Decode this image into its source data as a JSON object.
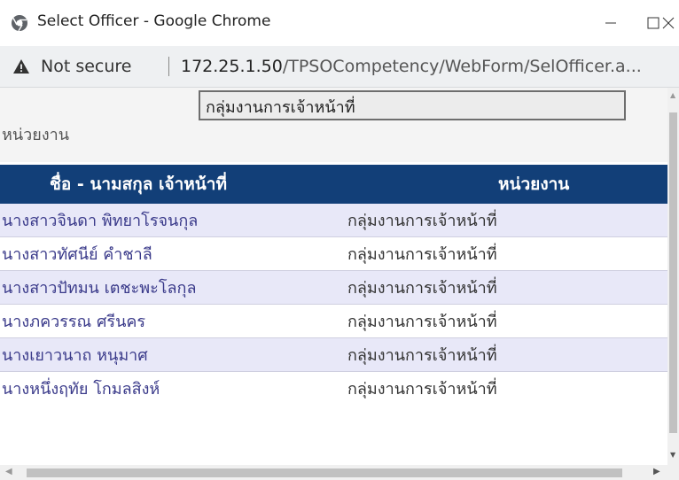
{
  "window": {
    "title": "Select Officer - Google Chrome",
    "controls": {
      "minimize": "—",
      "maximize": "☐",
      "close": "✕"
    },
    "icon": "chrome-globe-icon"
  },
  "address_bar": {
    "security_icon": "warning-triangle-icon",
    "security_text": "Not secure",
    "url_host": "172.25.1.50",
    "url_path": "/TPSOCompetency/WebForm/SelOfficer.a..."
  },
  "filter": {
    "label": "หน่วยงาน",
    "value": "กลุ่มงานการเจ้าหน้าที่"
  },
  "table": {
    "headers": {
      "name": "ชื่อ - นามสกุล เจ้าหน้าที่",
      "unit": "หน่วยงาน"
    },
    "rows": [
      {
        "name": "นางสาวจินดา พิทยาโรจนกุล",
        "unit": "กลุ่มงานการเจ้าหน้าที่"
      },
      {
        "name": "นางสาวทัศนีย์ คำชาลี",
        "unit": "กลุ่มงานการเจ้าหน้าที่"
      },
      {
        "name": "นางสาวปัทมน เตชะพะโลกุล",
        "unit": "กลุ่มงานการเจ้าหน้าที่"
      },
      {
        "name": "นางภควรรณ ศรีนคร",
        "unit": "กลุ่มงานการเจ้าหน้าที่"
      },
      {
        "name": "นางเยาวนาถ หนุมาศ",
        "unit": "กลุ่มงานการเจ้าหน้าที่"
      },
      {
        "name": "นางหนึ่งฤทัย โกมลสิงห์",
        "unit": "กลุ่มงานการเจ้าหน้าที่"
      }
    ]
  },
  "colors": {
    "header_bg": "#123f78",
    "row_alt_bg": "#e8e8f8",
    "name_text": "#3a3a8a"
  }
}
